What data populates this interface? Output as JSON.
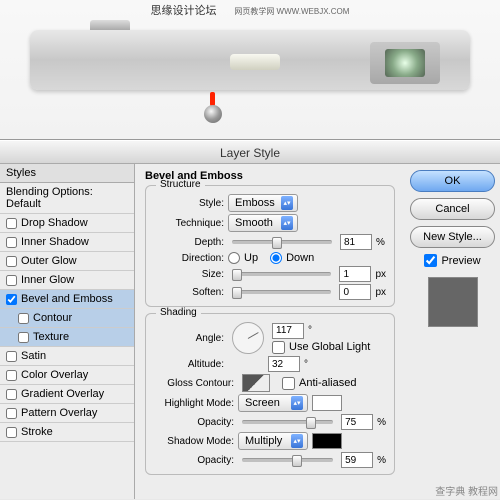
{
  "watermark": {
    "top_left": "思缘设计论坛",
    "top_right": "网页教学网 WWW.WEBJX.COM",
    "bottom": "查字典 教程网"
  },
  "dialog_title": "Layer Style",
  "styles": {
    "header": "Styles",
    "blending": "Blending Options: Default",
    "items": [
      {
        "label": "Drop Shadow",
        "checked": false
      },
      {
        "label": "Inner Shadow",
        "checked": false
      },
      {
        "label": "Outer Glow",
        "checked": false
      },
      {
        "label": "Inner Glow",
        "checked": false
      },
      {
        "label": "Bevel and Emboss",
        "checked": true,
        "selected": true
      },
      {
        "label": "Contour",
        "checked": false,
        "indent": true,
        "selected": true
      },
      {
        "label": "Texture",
        "checked": false,
        "indent": true,
        "selected": true
      },
      {
        "label": "Satin",
        "checked": false
      },
      {
        "label": "Color Overlay",
        "checked": false
      },
      {
        "label": "Gradient Overlay",
        "checked": false
      },
      {
        "label": "Pattern Overlay",
        "checked": false
      },
      {
        "label": "Stroke",
        "checked": false
      }
    ]
  },
  "main": {
    "title": "Bevel and Emboss",
    "structure": {
      "legend": "Structure",
      "style_label": "Style:",
      "style_value": "Emboss",
      "technique_label": "Technique:",
      "technique_value": "Smooth",
      "depth_label": "Depth:",
      "depth_value": "81",
      "depth_unit": "%",
      "direction_label": "Direction:",
      "up_label": "Up",
      "down_label": "Down",
      "size_label": "Size:",
      "size_value": "1",
      "size_unit": "px",
      "soften_label": "Soften:",
      "soften_value": "0",
      "soften_unit": "px"
    },
    "shading": {
      "legend": "Shading",
      "angle_label": "Angle:",
      "angle_value": "117",
      "angle_unit": "°",
      "global_label": "Use Global Light",
      "altitude_label": "Altitude:",
      "altitude_value": "32",
      "altitude_unit": "°",
      "gloss_label": "Gloss Contour:",
      "anti_alias": "Anti-aliased",
      "highlight_mode_label": "Highlight Mode:",
      "highlight_mode_value": "Screen",
      "highlight_color": "#ffffff",
      "highlight_opacity_value": "75",
      "shadow_mode_label": "Shadow Mode:",
      "shadow_mode_value": "Multiply",
      "shadow_color": "#000000",
      "shadow_opacity_value": "59",
      "opacity_label": "Opacity:",
      "opacity_unit": "%"
    }
  },
  "buttons": {
    "ok": "OK",
    "cancel": "Cancel",
    "new_style": "New Style...",
    "preview": "Preview"
  }
}
